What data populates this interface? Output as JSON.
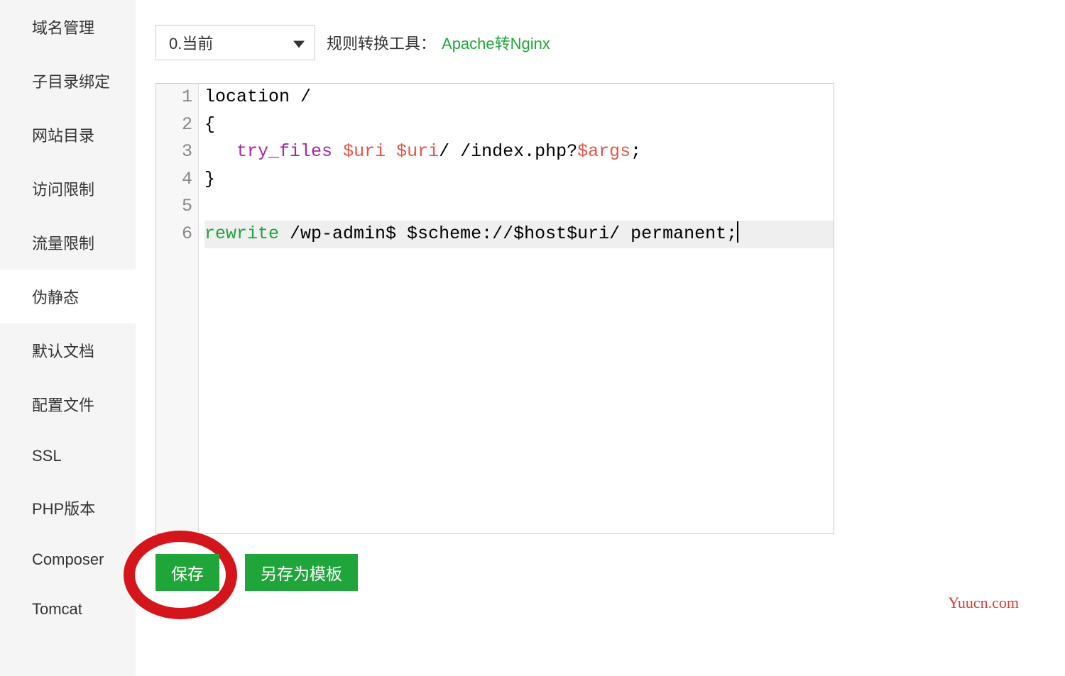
{
  "sidebar": {
    "items": [
      {
        "label": "域名管理",
        "active": false
      },
      {
        "label": "子目录绑定",
        "active": false
      },
      {
        "label": "网站目录",
        "active": false
      },
      {
        "label": "访问限制",
        "active": false
      },
      {
        "label": "流量限制",
        "active": false
      },
      {
        "label": "伪静态",
        "active": true
      },
      {
        "label": "默认文档",
        "active": false
      },
      {
        "label": "配置文件",
        "active": false
      },
      {
        "label": "SSL",
        "active": false
      },
      {
        "label": "PHP版本",
        "active": false
      },
      {
        "label": "Composer",
        "active": false
      },
      {
        "label": "Tomcat",
        "active": false
      }
    ]
  },
  "toolbar": {
    "select_value": "0.当前",
    "convert_label": "规则转换工具：",
    "convert_link": "Apache转Nginx"
  },
  "editor": {
    "lines": [
      [
        {
          "t": "location /",
          "c": ""
        }
      ],
      [
        {
          "t": "{",
          "c": ""
        }
      ],
      [
        {
          "t": "   ",
          "c": ""
        },
        {
          "t": "try_files",
          "c": "tok-keyword"
        },
        {
          "t": " ",
          "c": ""
        },
        {
          "t": "$uri",
          "c": "tok-var"
        },
        {
          "t": " ",
          "c": ""
        },
        {
          "t": "$uri",
          "c": "tok-var"
        },
        {
          "t": "/ /index.php?",
          "c": ""
        },
        {
          "t": "$args",
          "c": "tok-var"
        },
        {
          "t": ";",
          "c": ""
        }
      ],
      [
        {
          "t": "}",
          "c": ""
        }
      ],
      [
        {
          "t": "",
          "c": ""
        }
      ],
      [
        {
          "t": "rewrite",
          "c": "tok-special"
        },
        {
          "t": " /wp-admin$ $scheme://$host$uri/ permanent;",
          "c": ""
        }
      ]
    ],
    "active_line": 6
  },
  "buttons": {
    "save": "保存",
    "save_as_template": "另存为模板"
  },
  "watermark": "Yuucn.com"
}
